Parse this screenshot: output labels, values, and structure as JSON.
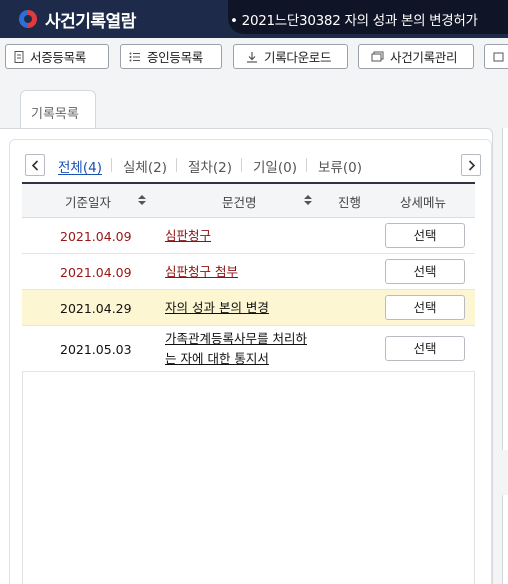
{
  "header": {
    "app_title": "사건기록열람",
    "case_title": "• 2021느단30382 자의 성과 본의 변경허가"
  },
  "toolbar": {
    "buttons": [
      {
        "label": "서증등목록",
        "icon": "document-icon"
      },
      {
        "label": "증인등목록",
        "icon": "list-icon"
      },
      {
        "label": "기록다운로드",
        "icon": "download-icon"
      },
      {
        "label": "사건기록관리",
        "icon": "folder-icon"
      }
    ]
  },
  "tab": {
    "label": "기록목록"
  },
  "filters": [
    {
      "label": "전체(4)",
      "active": true
    },
    {
      "label": "실체(2)",
      "active": false
    },
    {
      "label": "절차(2)",
      "active": false
    },
    {
      "label": "기일(0)",
      "active": false
    },
    {
      "label": "보류(0)",
      "active": false
    }
  ],
  "table": {
    "columns": [
      "기준일자",
      "문건명",
      "진행",
      "상세메뉴"
    ],
    "rows": [
      {
        "date": "2021.04.09",
        "doc": "심판청구",
        "doc2": "",
        "action": "선택",
        "color": "#9b1414",
        "highlight": false
      },
      {
        "date": "2021.04.09",
        "doc": "심판청구 첨부",
        "doc2": "",
        "action": "선택",
        "color": "#9b1414",
        "highlight": false
      },
      {
        "date": "2021.04.29",
        "doc": "자의 성과 본의 변경",
        "doc2": "",
        "action": "선택",
        "color": "#111111",
        "highlight": true
      },
      {
        "date": "2021.05.03",
        "doc": "가족관계등록사무를 처리하",
        "doc2": "는 자에 대한 통지서",
        "action": "선택",
        "color": "#111111",
        "highlight": false
      }
    ]
  },
  "colors": {
    "header_bg": "#1e2a4a",
    "active_filter": "#1a4fb3",
    "highlight_row": "#fdf6d3"
  }
}
